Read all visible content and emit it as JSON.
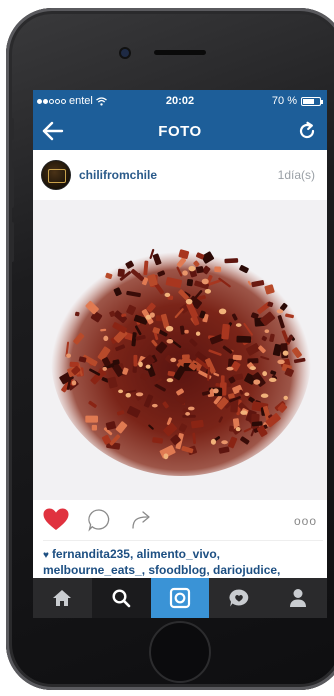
{
  "status_bar": {
    "carrier": "entel",
    "time": "20:02",
    "battery_text": "70 %",
    "battery_level": 0.7
  },
  "nav": {
    "title": "FOTO",
    "back_icon": "arrow-left-icon",
    "refresh_icon": "refresh-icon"
  },
  "post": {
    "username": "chilifromchile",
    "time_ago": "1día(s)",
    "liked": true,
    "likes_text": "fernandita235, alimento_vivo, melbourne_eats_, sfoodblog, dariojudice,",
    "more_label": "ooo"
  },
  "tabbar": {
    "items": [
      {
        "icon": "home-icon"
      },
      {
        "icon": "search-icon",
        "selected": true
      },
      {
        "icon": "camera-icon",
        "selected": true
      },
      {
        "icon": "activity-icon"
      },
      {
        "icon": "profile-icon"
      }
    ]
  },
  "colors": {
    "accent": "#1d5e99",
    "like": "#e0323f",
    "camera_tab": "#3a93d6"
  }
}
